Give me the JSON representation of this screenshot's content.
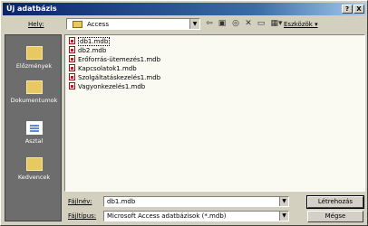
{
  "window": {
    "title": "Új adatbázis",
    "help_button": "?",
    "close_button": "X"
  },
  "location": {
    "label": "Hely:",
    "value": "Access"
  },
  "toolbar": {
    "tools_label": "Eszközök ▾"
  },
  "places": [
    {
      "label": "Előzmények",
      "icon": "history-icon"
    },
    {
      "label": "Dokumentumok",
      "icon": "documents-icon"
    },
    {
      "label": "Asztal",
      "icon": "desktop-icon"
    },
    {
      "label": "Kedvencek",
      "icon": "favorites-icon"
    }
  ],
  "files": [
    {
      "name": "db1.mdb"
    },
    {
      "name": "db2.mdb"
    },
    {
      "name": "Erőforrás-ütemezés1.mdb"
    },
    {
      "name": "Kapcsolatok1.mdb"
    },
    {
      "name": "Szolgáltatáskezelés1.mdb"
    },
    {
      "name": "Vagyonkezelés1.mdb"
    }
  ],
  "filename": {
    "label": "Fájlnév:",
    "value": "db1.mdb"
  },
  "filetype": {
    "label": "Fájltípus:",
    "value": "Microsoft Access adatbázisok (*.mdb)"
  },
  "buttons": {
    "create": "Létrehozás",
    "cancel": "Mégse"
  }
}
